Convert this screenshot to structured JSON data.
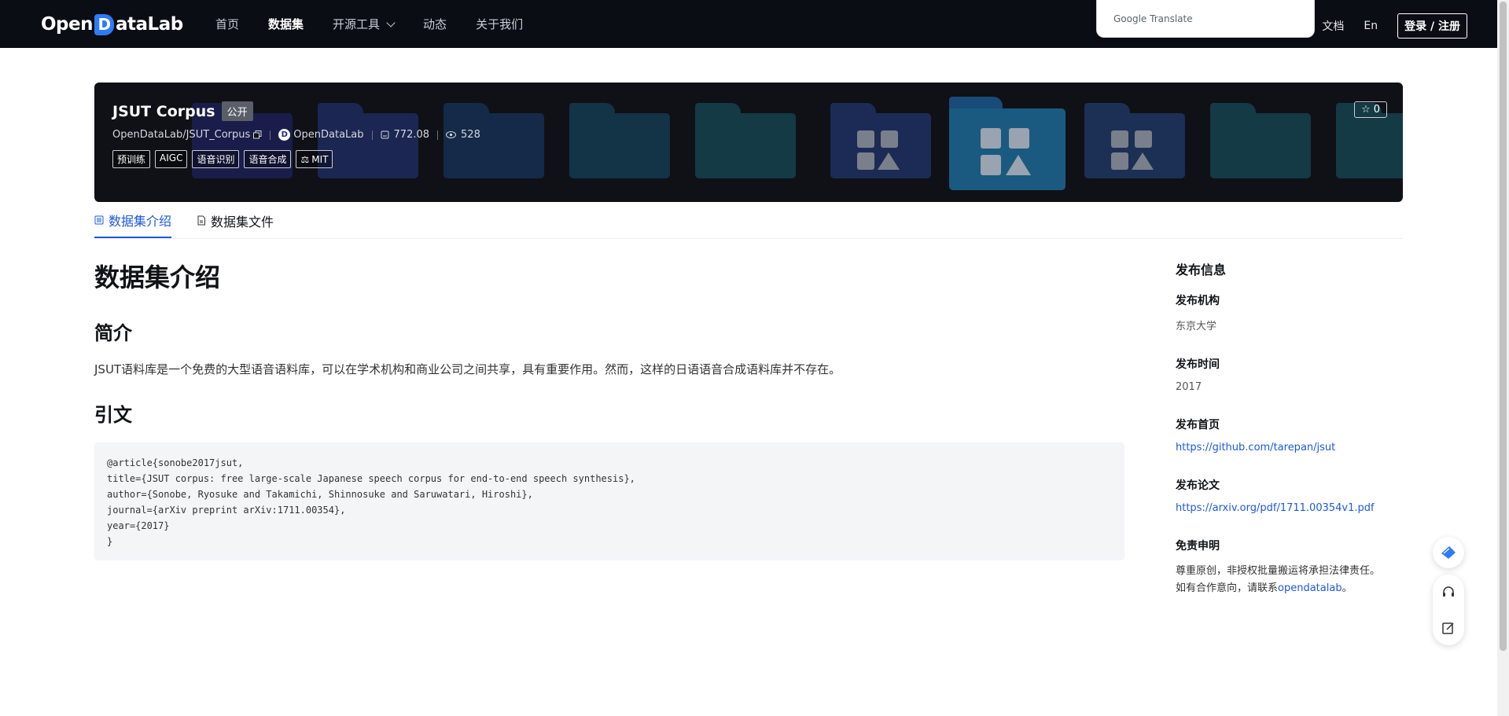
{
  "header": {
    "logo_left": "Open",
    "logo_mark": "D",
    "logo_right": "ataLab",
    "nav": [
      "首页",
      "数据集",
      "开源工具",
      "动态",
      "关于我们"
    ],
    "translate_popup": "Google Translate",
    "right_links": [
      "文档",
      "En"
    ],
    "login": "登录 / 注册"
  },
  "dataset": {
    "title": "JSUT Corpus",
    "visibility": "公开",
    "path": "OpenDataLab/JSUT_Corpus",
    "org": "OpenDataLab",
    "size": "772.08",
    "views": "528",
    "tags": [
      "预训练",
      "AIGC",
      "语音识别",
      "语音合成"
    ],
    "license": "MIT",
    "stars": "0"
  },
  "tabs": [
    "数据集介绍",
    "数据集文件"
  ],
  "content": {
    "heading": "数据集介绍",
    "intro_title": "简介",
    "intro_text": "JSUT语料库是一个免费的大型语音语料库，可以在学术机构和商业公司之间共享，具有重要作用。然而，这样的日语语音合成语料库并不存在。",
    "citation_title": "引文",
    "citation_lines": [
      "@article{sonobe2017jsut,",
      "title={JSUT corpus: free large-scale Japanese speech corpus for end-to-end speech synthesis},",
      "author={Sonobe, Ryosuke and Takamichi, Shinnosuke and Saruwatari, Hiroshi},",
      "journal={arXiv preprint arXiv:1711.00354},",
      "year={2017}",
      "}"
    ]
  },
  "sidebar": {
    "title": "发布信息",
    "org_label": "发布机构",
    "org_value": "东京大学",
    "time_label": "发布时间",
    "time_value": "2017",
    "home_label": "发布首页",
    "home_value": "https://github.com/tarepan/jsut",
    "paper_label": "发布论文",
    "paper_value": "https://arxiv.org/pdf/1711.00354v1.pdf",
    "disclaimer_label": "免责申明",
    "disclaimer_line1": "尊重原创，非授权批量搬运将承担法律责任。",
    "disclaimer_line2": "如有合作意向，请联系",
    "disclaimer_link": "opendatalab",
    "disclaimer_end": "。"
  },
  "colors": {
    "nav_bg": "#0b0d14",
    "accent": "#1c58e0",
    "banner_bg": "#0f1117"
  },
  "icons": [
    "copy-icon",
    "disk-icon",
    "eye-icon",
    "scale-icon",
    "star-icon",
    "list-icon",
    "file-icon",
    "feather-icon",
    "headset-icon",
    "edit-icon"
  ]
}
